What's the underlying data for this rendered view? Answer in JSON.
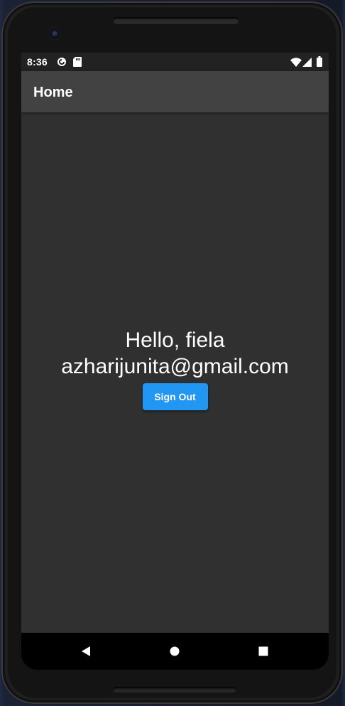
{
  "status_bar": {
    "time": "8:36",
    "icons": [
      "settings-sync-icon",
      "sd-card-icon",
      "wifi-icon",
      "cell-signal-icon",
      "battery-icon"
    ]
  },
  "app_bar": {
    "title": "Home"
  },
  "main": {
    "greeting": "Hello, fiela",
    "email": "azharijunita@gmail.com",
    "sign_out_label": "Sign Out"
  },
  "nav_bar": {
    "icons": [
      "back-icon",
      "home-icon",
      "recents-icon"
    ]
  },
  "colors": {
    "screen_background": "#303030",
    "app_bar": "#424242",
    "status_bar": "#222222",
    "button": "#2196f3",
    "nav_bar": "#000000"
  }
}
